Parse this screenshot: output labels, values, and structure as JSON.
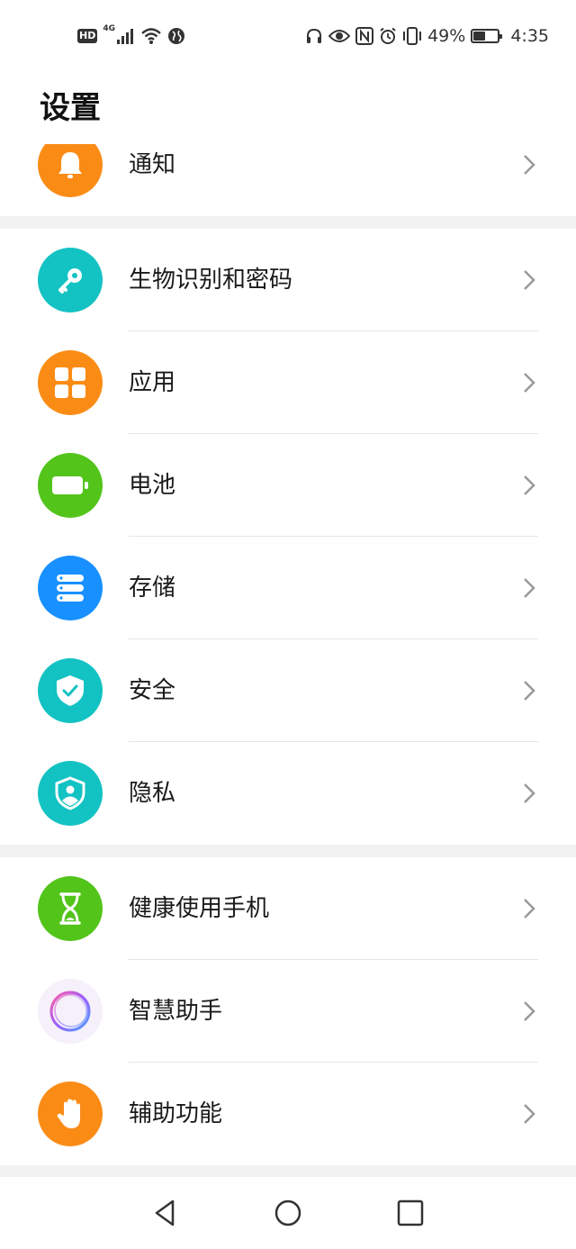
{
  "status_bar": {
    "hd_badge": "HD",
    "network_type": "4G",
    "battery_percent": "49%",
    "battery_level": 0.49,
    "time": "4:35",
    "left_icons": [
      "hd-icon",
      "cellular-signal-icon",
      "wifi-icon",
      "vpn-globe-icon"
    ],
    "right_icons": [
      "headset-icon",
      "eye-comfort-icon",
      "nfc-icon",
      "alarm-icon",
      "vibrate-icon",
      "battery-icon"
    ]
  },
  "page": {
    "title": "设置"
  },
  "groups": [
    {
      "items": [
        {
          "label": "通知",
          "icon": "bell-icon",
          "color": "#FA8C16"
        }
      ]
    },
    {
      "items": [
        {
          "label": "生物识别和密码",
          "icon": "key-icon",
          "color": "#13C2C2"
        },
        {
          "label": "应用",
          "icon": "apps-grid-icon",
          "color": "#FA8C16"
        },
        {
          "label": "电池",
          "icon": "battery-icon",
          "color": "#52C41A"
        },
        {
          "label": "存储",
          "icon": "storage-icon",
          "color": "#1890FF"
        },
        {
          "label": "安全",
          "icon": "shield-check-icon",
          "color": "#13C2C2"
        },
        {
          "label": "隐私",
          "icon": "privacy-shield-icon",
          "color": "#13C2C2"
        }
      ]
    },
    {
      "items": [
        {
          "label": "健康使用手机",
          "icon": "hourglass-icon",
          "color": "#52C41A"
        },
        {
          "label": "智慧助手",
          "icon": "assistant-ring-icon",
          "color": "#F5F0FA"
        },
        {
          "label": "辅助功能",
          "icon": "hand-icon",
          "color": "#FA8C16"
        }
      ]
    }
  ],
  "nav_bar": {
    "buttons": [
      "back-icon",
      "home-icon",
      "recents-icon"
    ]
  }
}
